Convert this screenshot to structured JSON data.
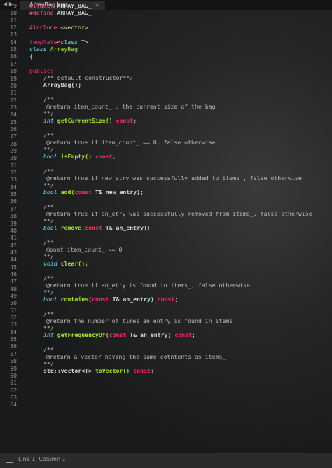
{
  "tab": {
    "nav_arrows": "◀ ▶",
    "title": "ArrayBag.hpp",
    "close": "×"
  },
  "line_numbers": [
    "9",
    "10",
    "11",
    "12",
    "13",
    "14",
    "15",
    "16",
    "17",
    "18",
    "19",
    "20",
    "21",
    "22",
    "23",
    "24",
    "25",
    "26",
    "27",
    "28",
    "29",
    "30",
    "31",
    "32",
    "33",
    "34",
    "35",
    "36",
    "37",
    "38",
    "39",
    "40",
    "41",
    "42",
    "43",
    "44",
    "45",
    "46",
    "47",
    "48",
    "49",
    "50",
    "51",
    "52",
    "53",
    "54",
    "55",
    "56",
    "57",
    "58",
    "59",
    "60",
    "61",
    "62",
    "63",
    "64"
  ],
  "code": {
    "l9_a": "#ifndef",
    "l9_b": " ARRAY_BAG_",
    "l10_a": "#define",
    "l10_b": " ARRAY_BAG_",
    "l12_a": "#include",
    "l12_b": " <vector>",
    "l14_a": "template",
    "l14_b": "<",
    "l14_c": "class",
    "l14_d": " T>",
    "l15_a": "class",
    "l15_b": " ArrayBag",
    "l16": "{",
    "l18": "public:",
    "l19": "/** default constructor**/",
    "l20": "ArrayBag();",
    "l22": "/**",
    "l23": "@return item_count_ : the current size of the bag",
    "l24": "**/",
    "l25_a": "int",
    "l25_b": " getCurrentSize() ",
    "l25_c": "const",
    "l27": "/**",
    "l28": "@return true if item_count_ == 0, false otherwise",
    "l29": "**/",
    "l30_a": "bool",
    "l30_b": " isEmpty() ",
    "l30_c": "const",
    "l32": "/**",
    "l33": "@return true if new_etry was successfully added to items_, false otherwise",
    "l34": "**/",
    "l35_a": "bool",
    "l35_b": " add(",
    "l35_c": "const",
    "l35_d": " T& new_entry);",
    "l37": "/**",
    "l38": "@return true if an_etry was successfully removed from items_, false otherwise",
    "l39": "**/",
    "l40_a": "bool",
    "l40_b": " remove(",
    "l40_c": "const",
    "l40_d": " T& an_entry);",
    "l42": "/**",
    "l43": "@post item_count_ == 0",
    "l44": "**/",
    "l45_a": "void",
    "l45_b": " clear();",
    "l47": "/**",
    "l48": "@return true if an_etry is found in items_, false otherwise",
    "l49": "**/",
    "l50_a": "bool",
    "l50_b": " contains(",
    "l50_c": "const",
    "l50_d": " T& an_entry) ",
    "l50_e": "const",
    "l52": "/**",
    "l53": "@return the number of times an_entry is found in items_",
    "l54": "**/",
    "l55_a": "int",
    "l55_b": " getFrequencyOf(",
    "l55_c": "const",
    "l55_d": " T& an_entry) ",
    "l55_e": "const",
    "l57": "/**",
    "l58": "@return a vector having the same cotntents as items_",
    "l59": "**/",
    "l60_a": "std::vector<T>",
    "l60_b": " toVector() ",
    "l60_c": "const",
    "semi": ";"
  },
  "status": {
    "position": "Line 1, Column 1"
  },
  "colors": {
    "background": "#1c1d1f",
    "preprocessor": "#f25a8a",
    "keyword": "#66d9ef",
    "function": "#a6e22e",
    "storage": "#f92672",
    "comment": "#b8b8b8"
  }
}
